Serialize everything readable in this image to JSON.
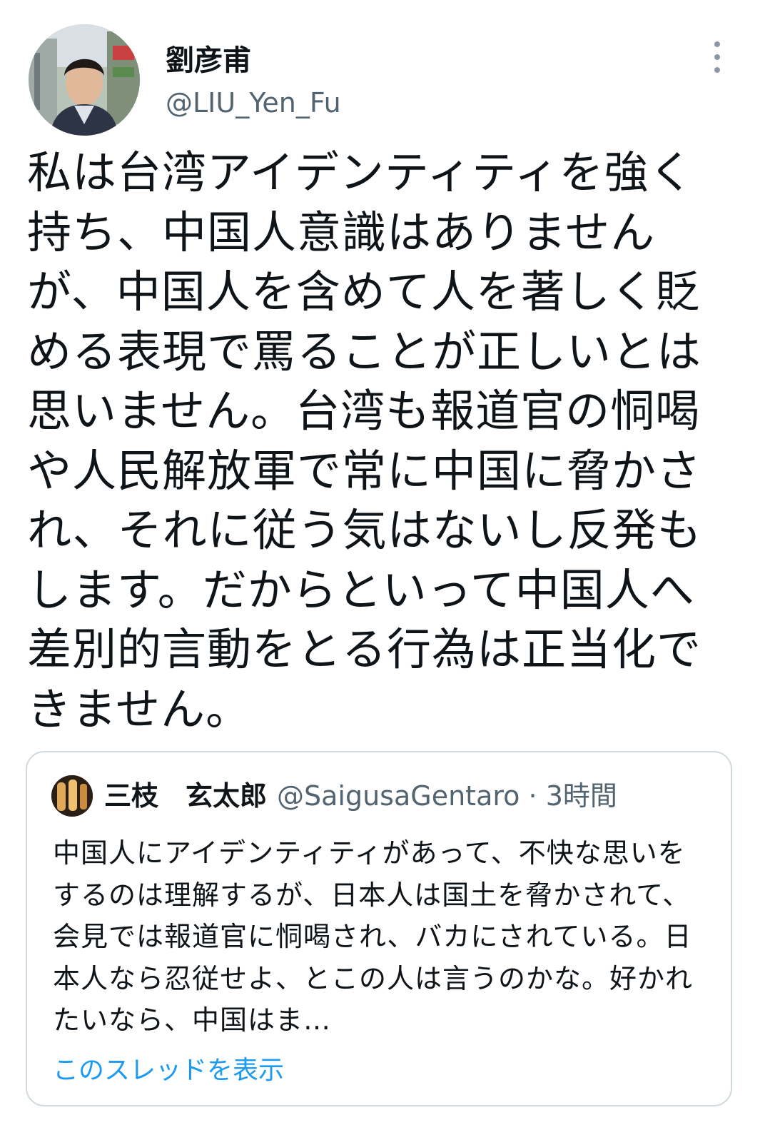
{
  "tweet": {
    "display_name": "劉彦甫",
    "handle": "@LIU_Yen_Fu",
    "text": "私は台湾アイデンティティを強く持ち、中国人意識はありませんが、中国人を含めて人を著しく貶める表現で罵ることが正しいとは思いません。台湾も報道官の恫喝や人民解放軍で常に中国に脅かされ、それに従う気はないし反発もします。だからといって中国人へ差別的言動をとる行為は正当化できません。"
  },
  "quoted_tweet": {
    "display_name": "三枝　玄太郎",
    "handle": "@SaigusaGentaro",
    "separator": "·",
    "time": "3時間",
    "text": "中国人にアイデンティティがあって、不快な思いをするのは理解するが、日本人は国土を脅かされて、会見では報道官に恫喝され、バカにされている。日本人なら忍従せよ、とこの人は言うのかな。好かれたいなら、中国はま…",
    "thread_link": "このスレッドを表示"
  },
  "icons": {
    "more": "more-vertical-icon"
  },
  "colors": {
    "link": "#1d9bf0",
    "secondary_text": "#536471",
    "primary_text": "#0f1419",
    "border": "#cfd9de"
  }
}
